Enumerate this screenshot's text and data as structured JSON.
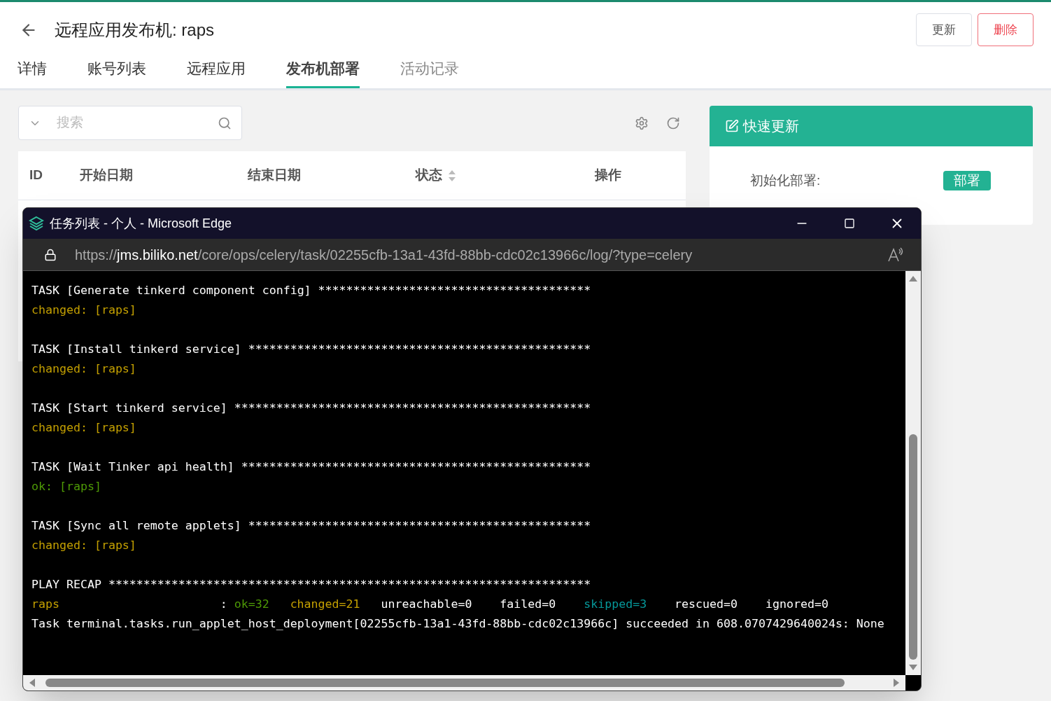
{
  "page": {
    "title": "远程应用发布机: raps",
    "actions": [
      {
        "label": "更新",
        "kind": "default"
      },
      {
        "label": "删除",
        "kind": "danger"
      }
    ],
    "tabs": [
      {
        "label": "详情",
        "selected": false,
        "disabled": false
      },
      {
        "label": "账号列表",
        "selected": false,
        "disabled": false
      },
      {
        "label": "远程应用",
        "selected": false,
        "disabled": false
      },
      {
        "label": "发布机部署",
        "selected": true,
        "disabled": false
      },
      {
        "label": "活动记录",
        "selected": false,
        "disabled": true
      }
    ],
    "search": {
      "placeholder": "搜索"
    },
    "table": {
      "columns": [
        {
          "label": "ID",
          "sortable": false
        },
        {
          "label": "开始日期",
          "sortable": false
        },
        {
          "label": "结束日期",
          "sortable": false
        },
        {
          "label": "状态",
          "sortable": true
        },
        {
          "label": "操作",
          "sortable": false
        }
      ]
    },
    "quick_update": {
      "title": "快速更新",
      "rows": [
        {
          "label": "初始化部署:",
          "button": "部署"
        }
      ]
    }
  },
  "browser_window": {
    "title": "任务列表 - 个人 - Microsoft Edge",
    "url_host": "https://jms.biliko.net",
    "url_path": "/core/ops/celery/task/02255cfb-13a1-43fd-88bb-cdc02c13966c/log/?type=celery",
    "terminal": {
      "tasks": [
        {
          "title": "TASK [Generate tinkerd component config] ***************************************",
          "result": "changed: [raps]",
          "kind": "changed"
        },
        {
          "title": "TASK [Install tinkerd service] *************************************************",
          "result": "changed: [raps]",
          "kind": "changed"
        },
        {
          "title": "TASK [Start tinkerd service] ***************************************************",
          "result": "changed: [raps]",
          "kind": "changed"
        },
        {
          "title": "TASK [Wait Tinker api health] **************************************************",
          "result": "ok: [raps]",
          "kind": "ok"
        },
        {
          "title": "TASK [Sync all remote applets] *************************************************",
          "result": "changed: [raps]",
          "kind": "changed"
        }
      ],
      "recap": {
        "title": "PLAY RECAP *********************************************************************",
        "host": "raps",
        "separator": ":",
        "stats": [
          {
            "text": "ok=32",
            "kind": "ok"
          },
          {
            "text": "changed=21",
            "kind": "changed"
          },
          {
            "text": "unreachable=0",
            "kind": "plain"
          },
          {
            "text": "failed=0",
            "kind": "plain"
          },
          {
            "text": "skipped=3",
            "kind": "skipped"
          },
          {
            "text": "rescued=0",
            "kind": "plain"
          },
          {
            "text": "ignored=0",
            "kind": "plain"
          }
        ]
      },
      "summary": "Task terminal.tasks.run_applet_host_deployment[02255cfb-13a1-43fd-88bb-cdc02c13966c] succeeded in 608.0707429640024s: None"
    }
  }
}
